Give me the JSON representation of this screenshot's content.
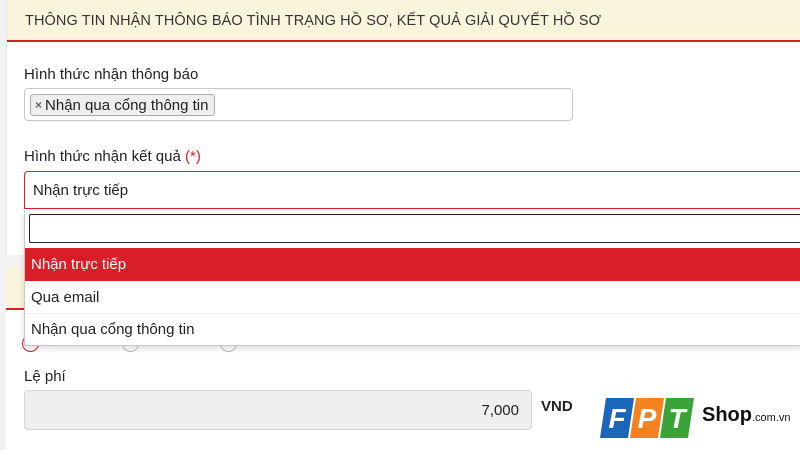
{
  "panel": {
    "title": "THÔNG TIN NHẬN THÔNG BÁO TÌNH TRẠNG HỒ SƠ, KẾT QUẢ GIẢI QUYẾT HỒ SƠ",
    "notification_label": "Hình thức nhận thông báo",
    "notification_tags": [
      "Nhận qua cổng thông tin"
    ],
    "result_label": "Hình thức nhận kết quả",
    "required_mark": "(*)",
    "result_selected": "Nhận trực tiếp",
    "search_value": ""
  },
  "dropdown": {
    "options": [
      "Nhận trực tiếp",
      "Qua email",
      "Nhận qua cổng thông tin"
    ],
    "highlighted_index": 0
  },
  "fee": {
    "label": "Lệ phí",
    "value": "7,000",
    "unit": "VND"
  },
  "watermark": {
    "letters": [
      "F",
      "P",
      "T"
    ],
    "text": "Shop",
    "domain": ".com.vn"
  },
  "colors": {
    "accent": "#d81e27",
    "header_bg": "#fbf4dc",
    "logo_blue": "#1a66b8",
    "logo_orange": "#f58220",
    "logo_green": "#3aa33a"
  }
}
